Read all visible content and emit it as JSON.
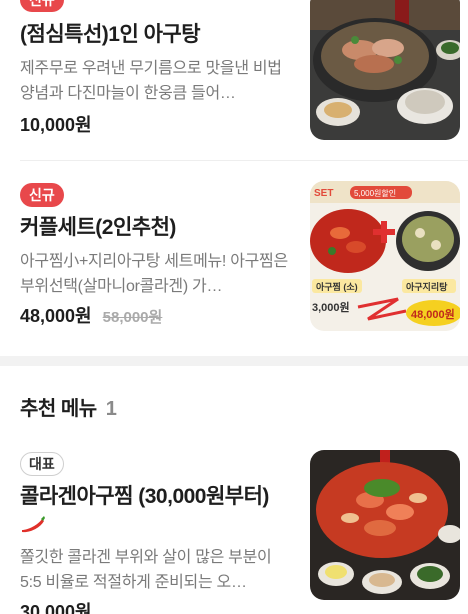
{
  "items": [
    {
      "badge": "",
      "name": "(점심특선)1인 아구탕",
      "desc": "제주무로 우려낸 무기름으로 맛을낸 비법양념과 다진마늘이 한웅큼 들어…",
      "price": "10,000원",
      "orig_price": ""
    },
    {
      "badge": "신규",
      "name": "커플세트(2인추천)",
      "desc": "아구찜小+지리아구탕 세트메뉴! 아구찜은 부위선택(살마니or콜라겐) 가…",
      "price": "48,000원",
      "orig_price": "58,000원"
    }
  ],
  "section": {
    "title": "추천 메뉴",
    "count": "1"
  },
  "recommended": {
    "badge": "대표",
    "name": "콜라겐아구찜 (30,000원부터)",
    "desc": "쫄깃한 콜라겐 부위와 살이 많은 부분이 5:5 비율로 적절하게 준비되는 오…",
    "price": "30,000원"
  },
  "top_badge": "신규",
  "image_text": {
    "set_label": "SET",
    "discount": "5,000원할인",
    "left_tag": "아구찜 (소)",
    "right_tag": "아구지리탕",
    "left_price": "3,000원",
    "right_price": "48,000원"
  },
  "colors": {
    "badge_new": "#e8484b",
    "text": "#1e1e1e",
    "muted": "#7a7a7a"
  }
}
